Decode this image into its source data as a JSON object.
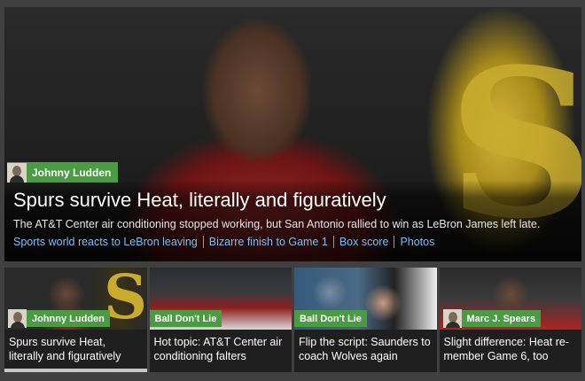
{
  "hero": {
    "author": "Johnny Ludden",
    "title": "Spurs survive Heat, literally and figuratively",
    "description": "The AT&T Center air conditioning stopped working, but San Antonio rallied to win as LeBron James left late.",
    "links": [
      "Sports world reacts to LeBron leaving",
      "Bizarre finish to Game 1",
      "Box score",
      "Photos"
    ]
  },
  "thumbs": [
    {
      "tag": "Johnny Ludden",
      "headline": "Spurs survive Heat, literally and figuratively"
    },
    {
      "tag": "Ball Don't Lie",
      "headline": "Hot topic: AT&T Center air conditioning falters"
    },
    {
      "tag": "Ball Don't Lie",
      "headline": "Flip the script: Saunders to coach Wolves again"
    },
    {
      "tag": "Marc J. Spears",
      "headline": "Slight difference: Heat re-member Game 6, too"
    }
  ],
  "colors": {
    "tag_green": "#4b9a44",
    "link_blue": "#7fbdf0"
  }
}
